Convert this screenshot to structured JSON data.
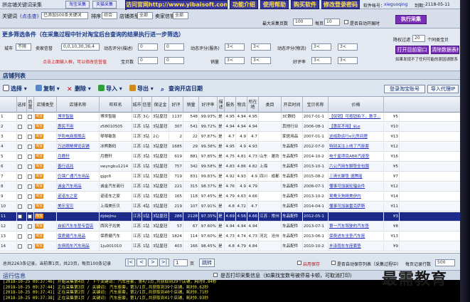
{
  "title": "拼店铺关键词采集",
  "topbar": {
    "keyword_label": "关键词",
    "keyword_hint": "(点击查)",
    "keyword_value": "已添加500条关键词",
    "sort_label": "排序",
    "sort_value": "综合",
    "shop_type_label": "店铺类型",
    "shop_type_value": "全部",
    "seller_level_label": "卖家信誉",
    "seller_level_value": "全部",
    "btn_website": "访问官网http://www.yibaisoft.com",
    "btn_features": "功能介绍",
    "btn_help": "使用帮助",
    "btn_buy": "购买软件",
    "btn_password": "修改登录密码",
    "user_label": "软件帐号：",
    "user_value": "xieguoqing",
    "expire_label": "到期：",
    "expire_value": "2118-05-11",
    "pages_label": "最大采集页数",
    "pages_value": "100",
    "interval_label": "每页",
    "interval_value": "10",
    "auto_label": "是否自动开展时",
    "run_button": "执行采集",
    "tag1": "淘宝采集",
    "tag2": "天猫采集"
  },
  "filter": {
    "heading": "更多筛选条件（在采集过程中针对淘宝后台查询的结果执行进一步筛选）",
    "city_label": "城市",
    "city_value": "不限",
    "seller_level_label": "卖家信誉",
    "seller_level_value": "0,0,10,30,36,4",
    "desc_label": "动态评分(描述)",
    "desc_from": "0",
    "desc_to": "0",
    "service_label": "动态评分(服务)",
    "service_from": "3<",
    "service_to": "3<",
    "logistics_label": "动态评分(物流)",
    "logistics_from": "3<",
    "logistics_to": "3<",
    "goods_label": "宝贝数",
    "goods_from": "0",
    "goods_to": "0",
    "sales_label": "销量",
    "sales_from": "3<",
    "sales_to": "3<",
    "rating_label": "好评率",
    "rating_from": "3<",
    "rating_to": "3<",
    "red_hint": "点击上面输入框，可以修改信誉值",
    "threshold_label": "降权过滤",
    "threshold_value": "20",
    "threshold_unit": "个同类宝贝",
    "btn_open_browser": "打开目前窗口",
    "btn_clear": "清除数据表格",
    "notice": "如果发现不了任何可能的原因请联系"
  },
  "list": {
    "heading": "店铺列表",
    "tools": {
      "select": "选择",
      "copy": "复制",
      "delete": "删除",
      "import": "导入",
      "export": "导出",
      "search": "查询开店日期"
    },
    "btn_login_taobao": "登录淘宝账号",
    "btn_import_proxy": "导入代理IP"
  },
  "grid": {
    "columns": [
      "选择",
      "后置",
      "店铺类型",
      "店铺名称",
      "旺旺名",
      "城市",
      "信誉",
      "保证金",
      "好评",
      "销量",
      "好评率",
      "描述",
      "服务",
      "物流",
      "所在地",
      "类目",
      "开店时间",
      "宝贝名称",
      "价格"
    ],
    "rows": [
      [
        "1",
        "",
        "淘宝",
        "博世智能",
        "博世智能",
        "江苏",
        "3心",
        "3钻皇冠",
        "1137",
        "548",
        "99.93%",
        "是",
        "4.95",
        "4.94",
        "4.95",
        "",
        "3C数码",
        "2017-01-1",
        "【促销】可按钮拍下，数字...",
        "¥5"
      ],
      [
        "2",
        "",
        "淘宝",
        "惠民不用",
        "z58010505",
        "江苏",
        "1钻",
        "3钻皇冠",
        "307",
        "541",
        "99.72%",
        "是",
        "4.94",
        "4.94",
        "4.94",
        "",
        "其他行业",
        "2006-08-1",
        "【惠民不用】$Le",
        "¥10"
      ],
      [
        "3",
        "",
        "淘宝",
        "华阳电商旗舰店",
        "琴琴敏急",
        "江苏",
        "3钻",
        "2心",
        "2",
        "22",
        "97.87%",
        "是",
        "4.7",
        "4.9",
        "4.7",
        "",
        "家居用品",
        "2007-01-1",
        "这成款运行e元房间理",
        "¥13"
      ],
      [
        "4",
        "",
        "淘宝",
        "万达眼睛博览店铺",
        "冰熊数码",
        "江苏",
        "1钻",
        "3钻皇冠",
        "1685",
        "29",
        "99.38%",
        "是",
        "4.95",
        "4.9",
        "4.93",
        "",
        "车品配件",
        "2012-07-0",
        "特别关注上线了汽座套",
        "¥12"
      ],
      [
        "5",
        "",
        "淘宝",
        "月鹿轩",
        "月鹿轩",
        "江苏",
        "3钻",
        "3钻皇冠",
        "619",
        "881",
        "97.85%",
        "是",
        "4.75",
        "4.81",
        "4.73",
        "山东 · 潍坊",
        "车品配件",
        "2014-10-2",
        "电千星项目ABR汽座垫",
        "¥16"
      ],
      [
        "6",
        "",
        "淘宝",
        "善行运兆",
        "swyngbu1214",
        "江苏",
        "1钻",
        "3钻皇冠",
        "757",
        "342",
        "99.58%",
        "是",
        "4.83",
        "4.86",
        "4.82",
        "上海",
        "车品配件",
        "2013-10-1",
        "六公汽用车脚垫全包围",
        "¥5"
      ],
      [
        "7",
        "",
        "淘宝",
        "仍锦广通汽车用品",
        "gjgc6",
        "江苏",
        "1钻",
        "3钻皇冠",
        "719",
        "831",
        "99.83%",
        "是",
        "4.92",
        "4.93",
        "4.9",
        "四川 · 成都",
        "车品配件",
        "2015-08-2",
        "三清长脚垫 速腾瑶",
        "¥7"
      ],
      [
        "8",
        "",
        "淘宝",
        "诚金汽车用品",
        "诚金汽车商行",
        "江苏",
        "1钻",
        "3钻皇冠",
        "221",
        "315",
        "98.37%",
        "是",
        "4.76",
        "4.9",
        "4.79",
        "",
        "车品配件",
        "2008-07-1",
        "懂事可加装轮辐合件",
        "¥12"
      ],
      [
        "9",
        "",
        "淘宝",
        "诺诺车之家",
        "诺诺车之家",
        "江苏",
        "1钻",
        "3钻皇冠",
        "165",
        "118",
        "97.45%",
        "是",
        "4.79",
        "4.63",
        "4.66",
        "",
        "车品配件",
        "2013-10-2",
        "鸳鸯天狗精美伊内",
        "¥14"
      ],
      [
        "10",
        "",
        "淘宝",
        "美乐宝贝",
        "上海美乐贝",
        "江苏",
        "4钻",
        "3钻皇冠",
        "219",
        "107",
        "97.91%",
        "是",
        "4.8",
        "4.72",
        "4.7",
        "",
        "车品配件",
        "2014-04-1",
        "懂事可加装雷克萨斯",
        "¥11"
      ],
      [
        "11",
        "",
        "淘宝",
        "",
        "djdejinu",
        "江苏",
        "1钻",
        "3钻皇冠",
        "286",
        "2128",
        "97.35%",
        "是",
        "4.69",
        "4.56",
        "4.66",
        "江苏 · 常州",
        "车品配件",
        "2012-05-1",
        "",
        "¥3"
      ],
      [
        "12",
        "",
        "淘宝",
        "自如汽车车垫专营店",
        "西风子兆美",
        "江苏",
        "1钻",
        "3钻皇冠",
        "57",
        "67",
        "97.60%",
        "是",
        "4.94",
        "4.94",
        "4.94",
        "",
        "车品配件",
        "2013-07-1",
        "第一汽车驾驶的汽车垫",
        "¥8"
      ],
      [
        "13",
        "",
        "淘宝",
        "保质健汽车用品",
        "保质健汽车",
        "江苏",
        "1钻",
        "3钻皇冠",
        "1824",
        "114",
        "97.60%",
        "是",
        "4.73",
        "4.74",
        "4.73",
        "河北 · 沧州",
        "车品配件",
        "2013-06-1",
        "保费进车坐垫汽车座",
        "¥13"
      ],
      [
        "14",
        "",
        "淘宝",
        "车俱雨车汽车用品",
        "1ju001010",
        "江苏",
        "1钻",
        "3钻皇冠",
        "403",
        "166",
        "98.45%",
        "是",
        "4.8",
        "4.79",
        "4.84",
        "",
        "车品配件",
        "2010-10-2",
        "丰泽雨车车座套垫",
        "¥9"
      ]
    ]
  },
  "pager": {
    "summary": "总共2263条记录，当前第1页，共23页，每页100条记录",
    "first": "|<",
    "prev": "<",
    "next": ">",
    "last": ">|",
    "page_value": "1",
    "page_unit": "页",
    "go": "跳转",
    "auto_label": "启用保存",
    "auto_save_label": "是否自动保存列表（采集过程中）",
    "per_page_label": "每页记录行数",
    "per_page_value": "500"
  },
  "log": {
    "heading": "运行信息",
    "hint": "是否打印采集信息（如果找宝数号被停易卡顿，可取消打印）",
    "lines": [
      "[2018-10-25 09:37:46] 开始采集第4页 / 下个关键词: 汽车座套，第4/1页,共获取到39个店铺，耗时0.84秒",
      "[2018-10-25 09:37:44] 正在采集第3页 / 关键词: 汽车座套，第3/1页,共获取到39个店铺，耗时0.62秒",
      "[2018-10-25 09:37:41] 正在采集第2页 / 关键词: 汽车座套，第2/1页,共获取到40个店铺，耗时0.71秒",
      "[2018-10-25 09:37:38] 正在采集第1页 / 关键词: 汽车座套，第1/1页,共获取到41个店铺，耗时0.93秒"
    ]
  },
  "watermark": "最需教育",
  "colors": {
    "selected_row": "#1c2a8a",
    "accent_purple": "#7a2fb8",
    "top_button": "#3a3aa0",
    "log_text": "#e9e24a"
  }
}
